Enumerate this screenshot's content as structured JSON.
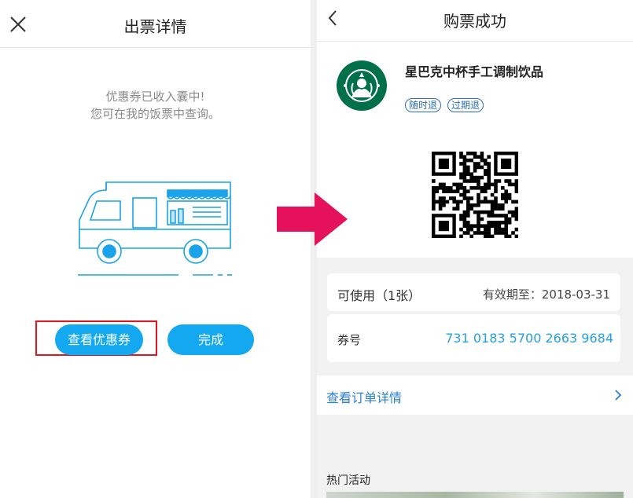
{
  "left": {
    "title": "出票详情",
    "message_line1": "优惠券已收入囊中!",
    "message_line2": "您可在我的饭票中查询。",
    "view_coupon_button": "查看优惠券",
    "done_button": "完成"
  },
  "right": {
    "title": "购票成功",
    "product_name": "星巴克中杯手工调制饮品",
    "tags": [
      "随时退",
      "过期退"
    ],
    "availability_label": "可使用（1张）",
    "validity": "有效期至：2018-03-31",
    "coupon_label": "券号",
    "coupon_number": "731 0183 5700 2663 9684",
    "order_detail_link": "查看订单详情",
    "section_title": "热门活动"
  },
  "colors": {
    "primary_blue": "#13a8f0",
    "highlight_red": "#e4141e",
    "arrow_pink": "#e5115a",
    "link_blue": "#2a7fd0",
    "starbucks_green": "#00704a"
  }
}
